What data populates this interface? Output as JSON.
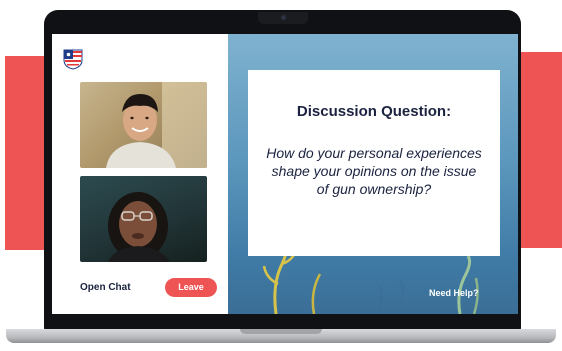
{
  "sidebar": {
    "logo_icon": "us-flag-shield-logo",
    "open_chat_label": "Open Chat",
    "leave_label": "Leave"
  },
  "discussion": {
    "heading": "Discussion Question:",
    "question": "How do your personal experiences shape your opinions on the issue of gun ownership?"
  },
  "footer": {
    "help_label": "Need Help?"
  },
  "colors": {
    "accent_red": "#ef5454",
    "navy_text": "#1b2340",
    "ocean_blue": "#5c97bd"
  }
}
